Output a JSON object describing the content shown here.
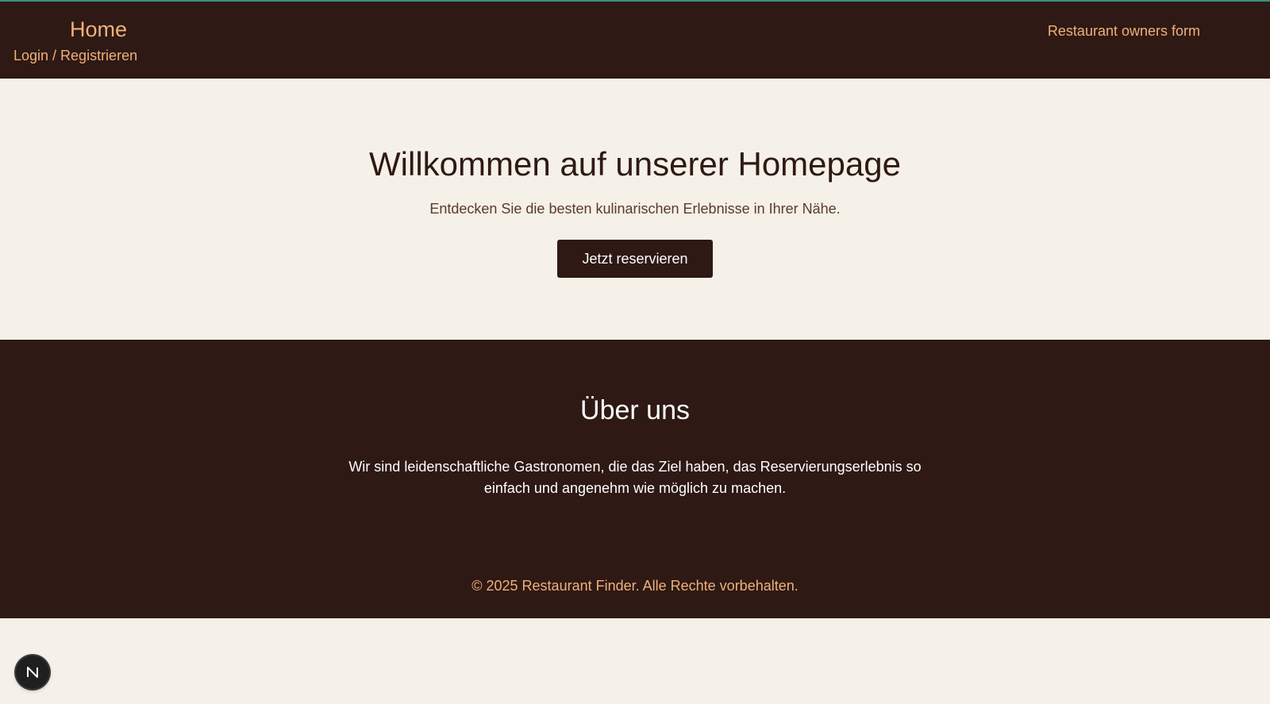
{
  "header": {
    "home_label": "Home",
    "login_label": "Login / Registrieren",
    "owners_label": "Restaurant owners form"
  },
  "hero": {
    "title": "Willkommen auf unserer Homepage",
    "subtitle": "Entdecken Sie die besten kulinarischen Erlebnisse in Ihrer Nähe.",
    "cta_label": "Jetzt reservieren"
  },
  "about": {
    "title": "Über uns",
    "text": "Wir sind leidenschaftliche Gastronomen, die das Ziel haben, das Reservierungserlebnis so einfach und angenehm wie möglich zu machen."
  },
  "footer": {
    "copyright": "© 2025 Restaurant Finder. Alle Rechte vorbehalten."
  },
  "dev_badge": {
    "icon": "nextjs-icon"
  },
  "colors": {
    "dark_brown": "#2e1914",
    "accent_orange": "#f0b07a",
    "cream": "#f5f0e8"
  }
}
